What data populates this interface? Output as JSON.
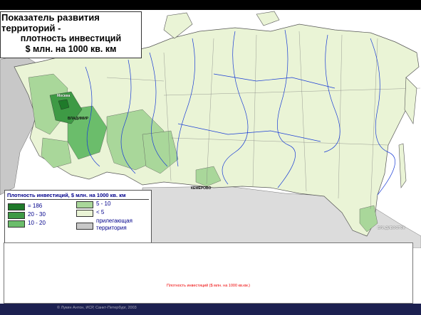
{
  "title": {
    "line1": "Показатель развития территорий -",
    "line2": "плотность инвестиций",
    "line3": "$ млн. на 1000 кв. км"
  },
  "legend": {
    "heading": "Плотность инвестиций, $ млн. на 1000 кв. км",
    "items": [
      {
        "label": "= 186",
        "color": "#1f7a2a"
      },
      {
        "label": "20 - 30",
        "color": "#3e9a45"
      },
      {
        "label": "10 - 20",
        "color": "#6bbd6b"
      },
      {
        "label": "5 - 10",
        "color": "#a9d79a"
      },
      {
        "label": "< 5",
        "color": "#eaf4d6"
      },
      {
        "label": "прилегающая территория",
        "label_line1": "прилегающая",
        "label_line2": "территория",
        "color": "#c8c8c8"
      }
    ]
  },
  "cities": {
    "moscow": "Москва",
    "vladimir": "ВЛАДИМИР",
    "kemerovo": "КЕМЕРОВО",
    "vladivostok": "ВЛАДИВОСТОК"
  },
  "caption": "Плотность инвестиций ($ млн. на 1000 кв.км.)",
  "footer": "© Лукин Антон, ИСР, Санкт-Петербург, 2003"
}
